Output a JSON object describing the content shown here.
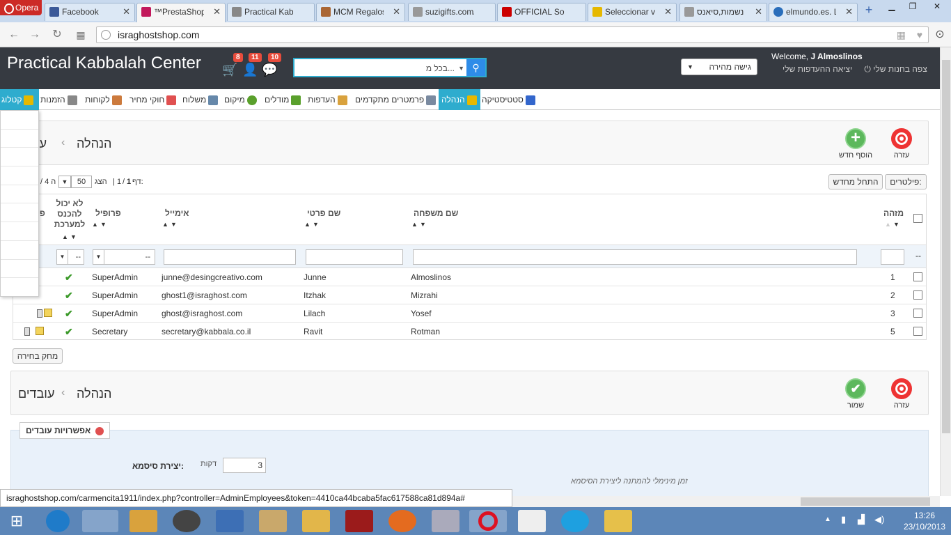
{
  "browser": {
    "opera_label": "Opera",
    "tabs": [
      {
        "label": "Facebook",
        "color": "#3b5998"
      },
      {
        "label": "™PrestaShop",
        "color": "#c2185b"
      },
      {
        "label": "Practical Kabb",
        "color": "#888888"
      },
      {
        "label": "MCM Regalos",
        "color": "#aa6633"
      },
      {
        "label": "suzigifts.com/",
        "color": "#999999"
      },
      {
        "label": "OFFICIAL Som",
        "color": "#cc0000"
      },
      {
        "label": "Seleccionar vu",
        "color": "#e6b800"
      },
      {
        "label": "נשמות,סיאנס",
        "color": "#999999"
      },
      {
        "label": "elmundo.es. L",
        "color": "#2a6ebb"
      }
    ],
    "close_glyph": "✕",
    "new_tab_glyph": "+",
    "url": "israghostshop.com"
  },
  "header": {
    "brand": "Practical Kabbalah Center",
    "badges": {
      "cart": "8",
      "customers": "11",
      "messages": "10"
    },
    "search_placeholder": "",
    "search_scope": "בכל מ...",
    "quick_access": "גישה מהירה",
    "welcome_prefix": "Welcome,",
    "welcome_name": "J Almoslinos",
    "links": {
      "prefs": "ההעדפות שלי",
      "logout": "יציאה",
      "view_shop": "צפה בחנות שלי"
    }
  },
  "menu": [
    {
      "label": "קטלוג",
      "icon": "catalog-icon",
      "color": "#e6b800"
    },
    {
      "label": "הזמנות",
      "icon": "cart-icon",
      "color": "#888888"
    },
    {
      "label": "לקוחות",
      "icon": "customer-icon",
      "color": "#cc7a3d"
    },
    {
      "label": "חוקי מחיר",
      "icon": "price-icon",
      "color": "#e05050"
    },
    {
      "label": "משלוח",
      "icon": "truck-icon",
      "color": "#6688aa"
    },
    {
      "label": "מיקום",
      "icon": "globe-icon",
      "color": "#5aa02c"
    },
    {
      "label": "מודלים",
      "icon": "puzzle-icon",
      "color": "#5aa02c"
    },
    {
      "label": "העדפות",
      "icon": "prefs-icon",
      "color": "#d9a23d"
    },
    {
      "label": "פרמטרים מתקדמים",
      "icon": "wrench-icon",
      "color": "#7a8aa0"
    },
    {
      "label": "הנהלה",
      "icon": "key-icon",
      "color": "#e6b800"
    },
    {
      "label": "סטטיסטיקה",
      "icon": "stats-icon",
      "color": "#3366cc"
    }
  ],
  "list_panel": {
    "breadcrumb_parent": "הנהלה",
    "breadcrumb_current": "עו",
    "help_label": "עזרה",
    "add_label": "הוסף חדש"
  },
  "pagination": {
    "page_label": "דף:",
    "page_current": "1",
    "page_total": "1",
    "show_label": "הצג",
    "per_page": "50",
    "count_fragment": "/ 4 ה",
    "filters_label": "פילטרים:",
    "reset_label": "התחל מחדש"
  },
  "table": {
    "headers": {
      "id": "מזהה",
      "lastname": "שם משפחה",
      "firstname": "שם פרטי",
      "email": "אימייל",
      "profile": "פרופיל",
      "active_1": "לא יכול",
      "active_2": "להכנס",
      "active_3": "למערכת",
      "actions": "פ"
    },
    "filter_select": "--",
    "rows": [
      {
        "id": "1",
        "lastname": "Almoslinos",
        "firstname": "Junne",
        "email": "junne@desingcreativo.com",
        "profile": "SuperAdmin"
      },
      {
        "id": "2",
        "lastname": "Mizrahi",
        "firstname": "Itzhak",
        "email": "ghost1@israghost.com",
        "profile": "SuperAdmin"
      },
      {
        "id": "3",
        "lastname": "Yosef",
        "firstname": "Lilach",
        "email": "ghost@israghost.com",
        "profile": "SuperAdmin"
      },
      {
        "id": "5",
        "lastname": "Rotman",
        "firstname": "Ravit",
        "email": "secretary@kabbala.co.il",
        "profile": "Secretary"
      }
    ],
    "tick": "✔",
    "delete_selected": "מחק בחירה"
  },
  "edit_panel": {
    "breadcrumb_parent": "הנהלה",
    "breadcrumb_current": "עובדים",
    "help_label": "עזרה",
    "save_label": "שמור"
  },
  "options": {
    "legend": "אפשרויות עובדים",
    "password_label": "יצירת סיסמא:",
    "password_value": "3",
    "unit": "דקות",
    "hint": "זמן מינימלי להמתנה ליצירת הסיסמא"
  },
  "status_url": "israghostshop.com/carmencita1911/index.php?controller=AdminEmployees&token=4410ca44bcaba5fac617588ca81d894a#",
  "taskbar": {
    "time": "13:26",
    "date": "23/10/2013"
  }
}
